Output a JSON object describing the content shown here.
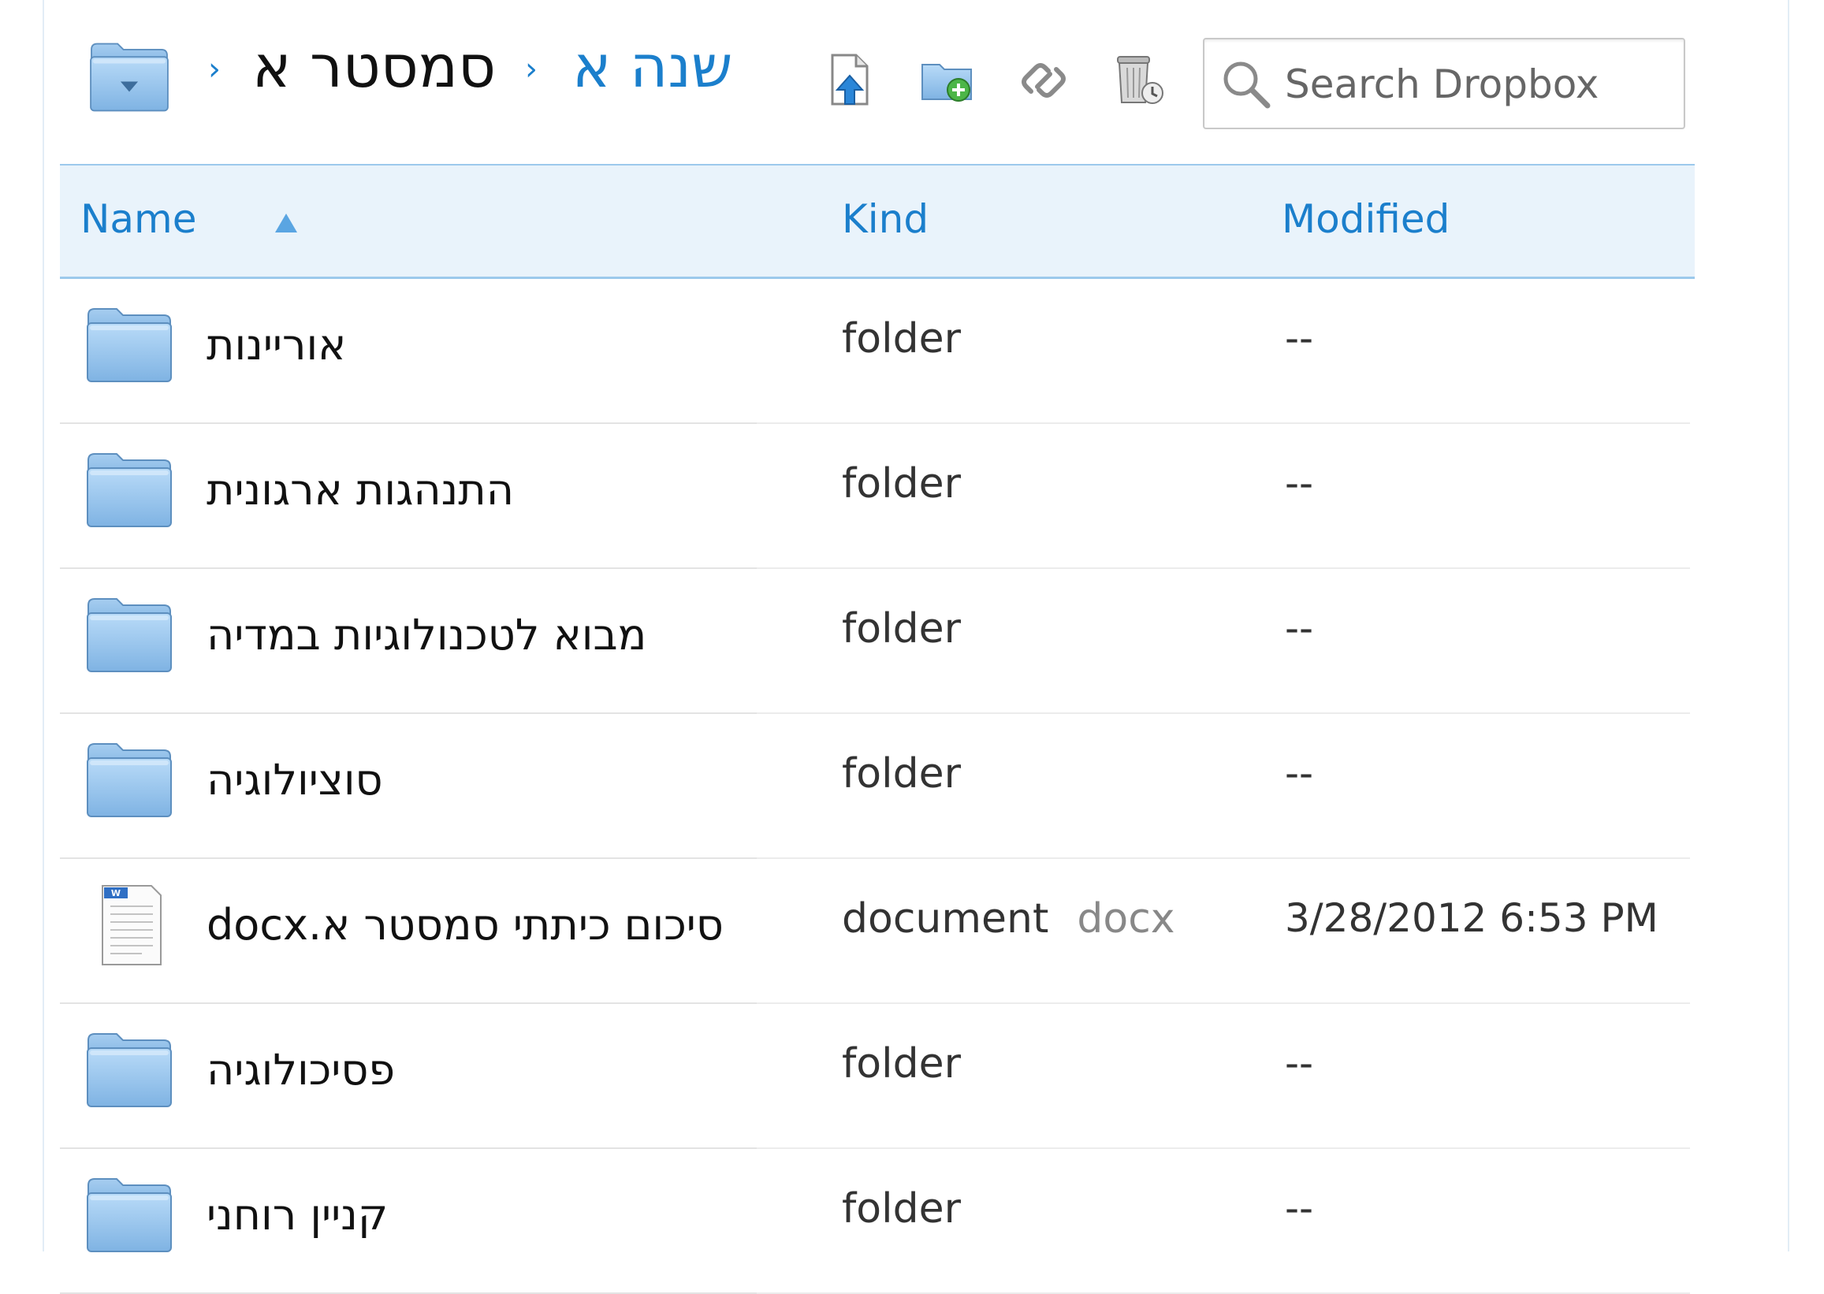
{
  "breadcrumb": {
    "parent": "שנה א",
    "current": "סמסטר א"
  },
  "toolbar": {
    "upload": "upload-icon",
    "new_folder": "new-folder-icon",
    "share_link": "link-icon",
    "deleted_files": "trash-icon"
  },
  "search": {
    "placeholder": "Search Dropbox"
  },
  "table": {
    "columns": {
      "name": "Name",
      "kind": "Kind",
      "modified": "Modified"
    },
    "sort": "ascending",
    "rows": [
      {
        "name": "אוריינות",
        "kind": "folder",
        "ext": "",
        "modified": "--",
        "icon": "folder-icon"
      },
      {
        "name": "התנהגות ארגונית",
        "kind": "folder",
        "ext": "",
        "modified": "--",
        "icon": "folder-icon"
      },
      {
        "name": "מבוא לטכנולוגיות במדיה",
        "kind": "folder",
        "ext": "",
        "modified": "--",
        "icon": "folder-icon"
      },
      {
        "name": "סוציולוגיה",
        "kind": "folder",
        "ext": "",
        "modified": "--",
        "icon": "folder-icon"
      },
      {
        "name": "סיכום כיתתי סמסטר א.docx",
        "kind": "document",
        "ext": "docx",
        "modified": "3/28/2012 6:53 PM",
        "icon": "word-document-icon"
      },
      {
        "name": "פסיכולוגיה",
        "kind": "folder",
        "ext": "",
        "modified": "--",
        "icon": "folder-icon"
      },
      {
        "name": "קניין רוחני",
        "kind": "folder",
        "ext": "",
        "modified": "--",
        "icon": "folder-icon"
      }
    ]
  },
  "colors": {
    "accent": "#1b7fcc",
    "header_bg": "#e9f3fb",
    "folder_blue": "#8fc0ec"
  }
}
